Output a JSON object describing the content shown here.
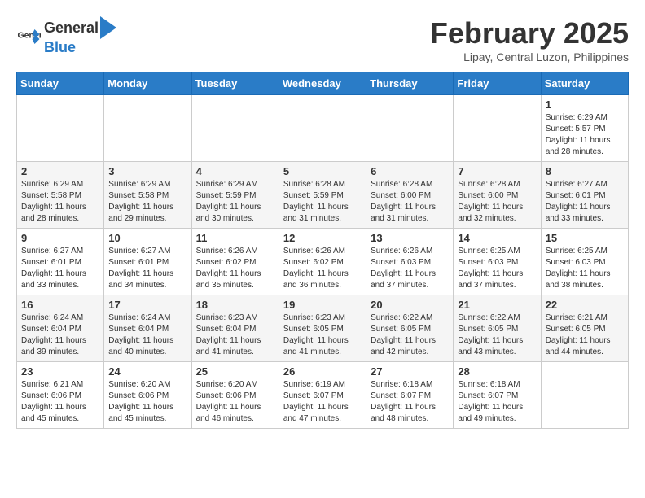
{
  "header": {
    "logo_general": "General",
    "logo_blue": "Blue",
    "month_year": "February 2025",
    "location": "Lipay, Central Luzon, Philippines"
  },
  "weekdays": [
    "Sunday",
    "Monday",
    "Tuesday",
    "Wednesday",
    "Thursday",
    "Friday",
    "Saturday"
  ],
  "weeks": [
    [
      {
        "day": "",
        "info": ""
      },
      {
        "day": "",
        "info": ""
      },
      {
        "day": "",
        "info": ""
      },
      {
        "day": "",
        "info": ""
      },
      {
        "day": "",
        "info": ""
      },
      {
        "day": "",
        "info": ""
      },
      {
        "day": "1",
        "info": "Sunrise: 6:29 AM\nSunset: 5:57 PM\nDaylight: 11 hours and 28 minutes."
      }
    ],
    [
      {
        "day": "2",
        "info": "Sunrise: 6:29 AM\nSunset: 5:58 PM\nDaylight: 11 hours and 28 minutes."
      },
      {
        "day": "3",
        "info": "Sunrise: 6:29 AM\nSunset: 5:58 PM\nDaylight: 11 hours and 29 minutes."
      },
      {
        "day": "4",
        "info": "Sunrise: 6:29 AM\nSunset: 5:59 PM\nDaylight: 11 hours and 30 minutes."
      },
      {
        "day": "5",
        "info": "Sunrise: 6:28 AM\nSunset: 5:59 PM\nDaylight: 11 hours and 31 minutes."
      },
      {
        "day": "6",
        "info": "Sunrise: 6:28 AM\nSunset: 6:00 PM\nDaylight: 11 hours and 31 minutes."
      },
      {
        "day": "7",
        "info": "Sunrise: 6:28 AM\nSunset: 6:00 PM\nDaylight: 11 hours and 32 minutes."
      },
      {
        "day": "8",
        "info": "Sunrise: 6:27 AM\nSunset: 6:01 PM\nDaylight: 11 hours and 33 minutes."
      }
    ],
    [
      {
        "day": "9",
        "info": "Sunrise: 6:27 AM\nSunset: 6:01 PM\nDaylight: 11 hours and 33 minutes."
      },
      {
        "day": "10",
        "info": "Sunrise: 6:27 AM\nSunset: 6:01 PM\nDaylight: 11 hours and 34 minutes."
      },
      {
        "day": "11",
        "info": "Sunrise: 6:26 AM\nSunset: 6:02 PM\nDaylight: 11 hours and 35 minutes."
      },
      {
        "day": "12",
        "info": "Sunrise: 6:26 AM\nSunset: 6:02 PM\nDaylight: 11 hours and 36 minutes."
      },
      {
        "day": "13",
        "info": "Sunrise: 6:26 AM\nSunset: 6:03 PM\nDaylight: 11 hours and 37 minutes."
      },
      {
        "day": "14",
        "info": "Sunrise: 6:25 AM\nSunset: 6:03 PM\nDaylight: 11 hours and 37 minutes."
      },
      {
        "day": "15",
        "info": "Sunrise: 6:25 AM\nSunset: 6:03 PM\nDaylight: 11 hours and 38 minutes."
      }
    ],
    [
      {
        "day": "16",
        "info": "Sunrise: 6:24 AM\nSunset: 6:04 PM\nDaylight: 11 hours and 39 minutes."
      },
      {
        "day": "17",
        "info": "Sunrise: 6:24 AM\nSunset: 6:04 PM\nDaylight: 11 hours and 40 minutes."
      },
      {
        "day": "18",
        "info": "Sunrise: 6:23 AM\nSunset: 6:04 PM\nDaylight: 11 hours and 41 minutes."
      },
      {
        "day": "19",
        "info": "Sunrise: 6:23 AM\nSunset: 6:05 PM\nDaylight: 11 hours and 41 minutes."
      },
      {
        "day": "20",
        "info": "Sunrise: 6:22 AM\nSunset: 6:05 PM\nDaylight: 11 hours and 42 minutes."
      },
      {
        "day": "21",
        "info": "Sunrise: 6:22 AM\nSunset: 6:05 PM\nDaylight: 11 hours and 43 minutes."
      },
      {
        "day": "22",
        "info": "Sunrise: 6:21 AM\nSunset: 6:05 PM\nDaylight: 11 hours and 44 minutes."
      }
    ],
    [
      {
        "day": "23",
        "info": "Sunrise: 6:21 AM\nSunset: 6:06 PM\nDaylight: 11 hours and 45 minutes."
      },
      {
        "day": "24",
        "info": "Sunrise: 6:20 AM\nSunset: 6:06 PM\nDaylight: 11 hours and 45 minutes."
      },
      {
        "day": "25",
        "info": "Sunrise: 6:20 AM\nSunset: 6:06 PM\nDaylight: 11 hours and 46 minutes."
      },
      {
        "day": "26",
        "info": "Sunrise: 6:19 AM\nSunset: 6:07 PM\nDaylight: 11 hours and 47 minutes."
      },
      {
        "day": "27",
        "info": "Sunrise: 6:18 AM\nSunset: 6:07 PM\nDaylight: 11 hours and 48 minutes."
      },
      {
        "day": "28",
        "info": "Sunrise: 6:18 AM\nSunset: 6:07 PM\nDaylight: 11 hours and 49 minutes."
      },
      {
        "day": "",
        "info": ""
      }
    ]
  ]
}
